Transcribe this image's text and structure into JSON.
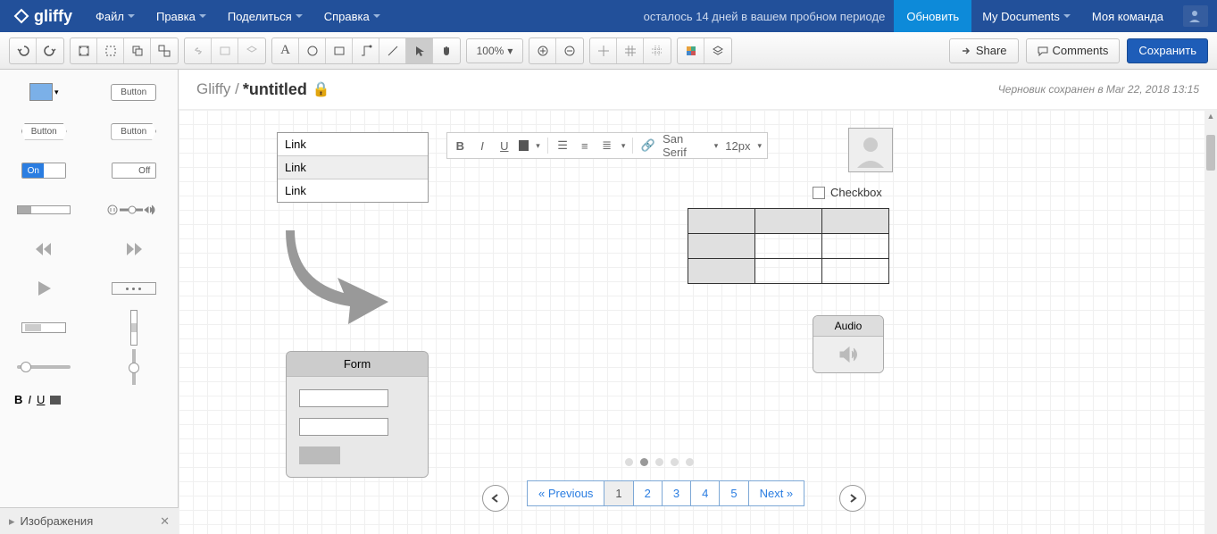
{
  "header": {
    "logo": "gliffy",
    "menu": [
      "Файл",
      "Правка",
      "Поделиться",
      "Справка"
    ],
    "trial": "осталось 14 дней в вашем пробном периоде",
    "upgrade": "Обновить",
    "my_docs": "My Documents",
    "team": "Моя команда"
  },
  "toolbar": {
    "zoom": "100%",
    "share": "Share",
    "comments": "Comments",
    "save": "Сохранить"
  },
  "doc": {
    "breadcrumb": "Gliffy /",
    "title": "*untitled",
    "status": "Черновик сохранен в Mar 22, 2018 13:15"
  },
  "sidebar": {
    "button_label": "Button",
    "on": "On",
    "off": "Off",
    "format_b": "B",
    "format_i": "I",
    "format_u": "U",
    "images_section": "Изображения"
  },
  "canvas": {
    "links": [
      "Link",
      "Link",
      "Link"
    ],
    "form_title": "Form",
    "checkbox_label": "Checkbox",
    "audio_label": "Audio",
    "text_toolbar": {
      "font": "San Serif",
      "size": "12px",
      "b": "B",
      "i": "I",
      "u": "U"
    },
    "pagination": {
      "prev": "« Previous",
      "pages": [
        "1",
        "2",
        "3",
        "4",
        "5"
      ],
      "next": "Next »",
      "active": 0
    }
  }
}
